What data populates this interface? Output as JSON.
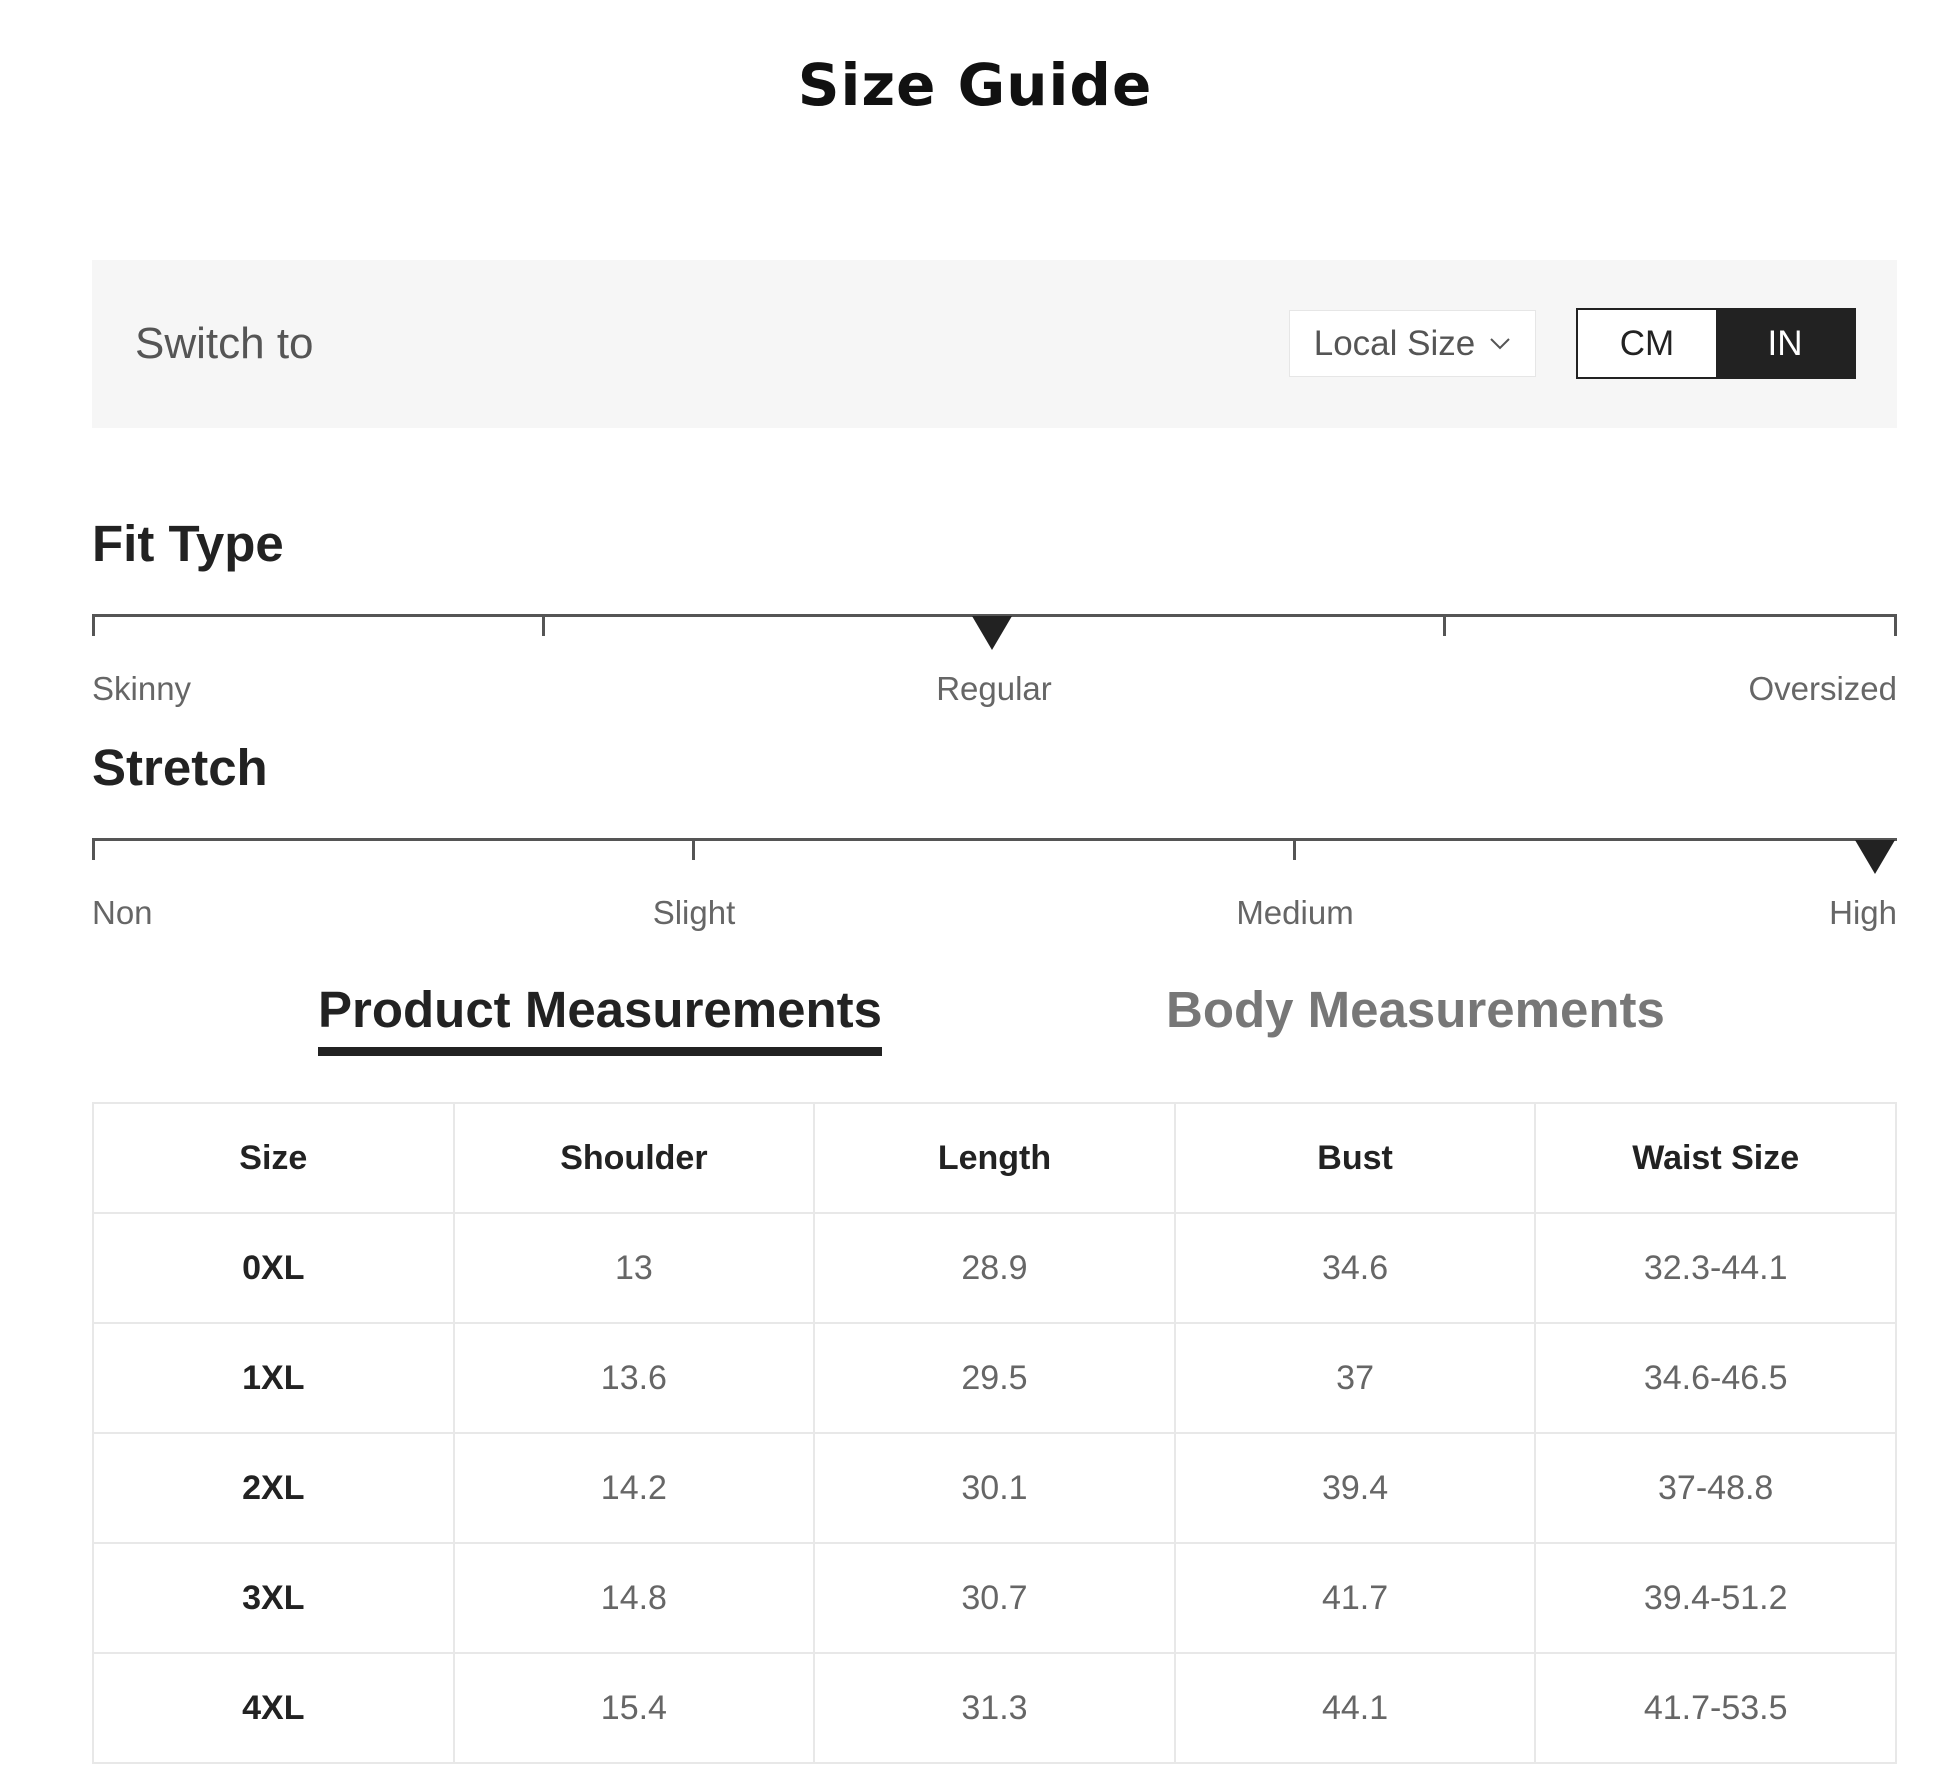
{
  "title": "Size Guide",
  "switch_bar": {
    "label": "Switch to",
    "local_size": "Local Size",
    "units": [
      "CM",
      "IN"
    ],
    "selected_unit": "IN"
  },
  "fit_type": {
    "title": "Fit Type",
    "labels": [
      "Skinny",
      "Regular",
      "Oversized"
    ],
    "selected": "Regular"
  },
  "stretch": {
    "title": "Stretch",
    "labels": [
      "Non",
      "Slight",
      "Medium",
      "High"
    ],
    "selected": "High"
  },
  "tabs": [
    {
      "label": "Product Measurements",
      "active": true
    },
    {
      "label": "Body Measurements",
      "active": false
    }
  ],
  "table": {
    "headers": [
      "Size",
      "Shoulder",
      "Length",
      "Bust",
      "Waist Size"
    ],
    "rows": [
      [
        "0XL",
        "13",
        "28.9",
        "34.6",
        "32.3-44.1"
      ],
      [
        "1XL",
        "13.6",
        "29.5",
        "37",
        "34.6-46.5"
      ],
      [
        "2XL",
        "14.2",
        "30.1",
        "39.4",
        "37-48.8"
      ],
      [
        "3XL",
        "14.8",
        "30.7",
        "41.7",
        "39.4-51.2"
      ],
      [
        "4XL",
        "15.4",
        "31.3",
        "44.1",
        "41.7-53.5"
      ]
    ]
  },
  "colors": {
    "accent": "#222222",
    "muted_text": "#666666",
    "panel_bg": "#f6f6f6",
    "border": "#e8e8e8"
  },
  "icons": {
    "dropdown": "chevron-down-icon"
  }
}
